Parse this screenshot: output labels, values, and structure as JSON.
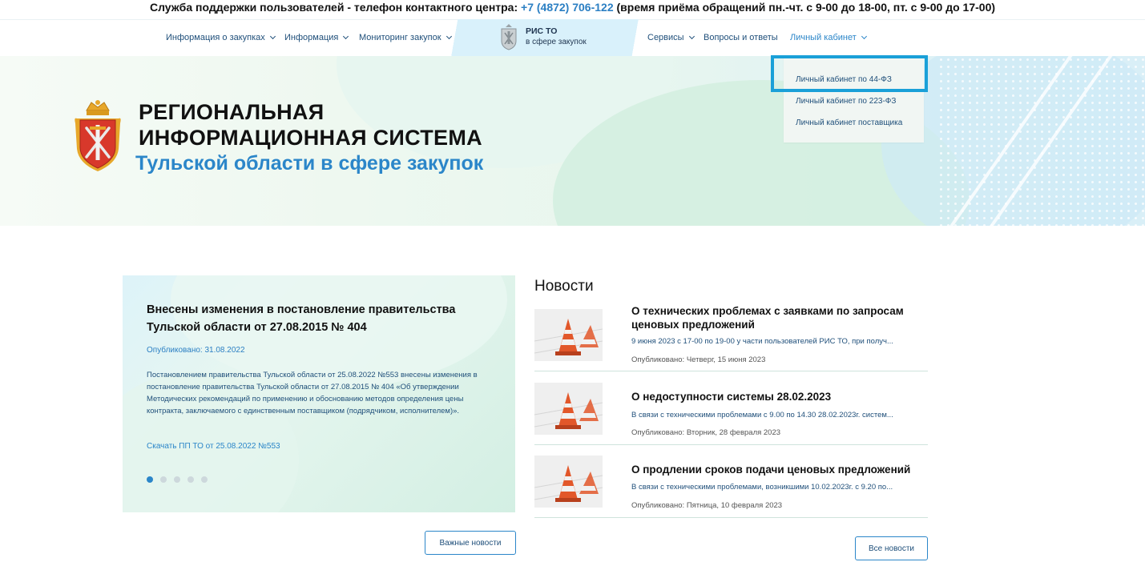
{
  "support": {
    "prefix": "Служба поддержки пользователей - телефон контактного центра: ",
    "phone": "+7 (4872) 706-122",
    "suffix": " (время приёма обращений пн.-чт. с 9-00 до 18-00, пт. с 9-00 до 17-00)"
  },
  "nav": {
    "left": [
      {
        "label": "Информация о закупках"
      },
      {
        "label": "Информация"
      },
      {
        "label": "Мониторинг закупок"
      }
    ],
    "right": [
      {
        "label": "Сервисы"
      },
      {
        "label": "Вопросы и ответы"
      },
      {
        "label": "Личный кабинет"
      }
    ],
    "logo_line1": "РИС ТО",
    "logo_line2": "в сфере закупок"
  },
  "hero": {
    "title_line1": "РЕГИОНАЛЬНАЯ",
    "title_line2": "ИНФОРМАЦИОННАЯ СИСТЕМА",
    "subtitle": "Тульской области в сфере закупок"
  },
  "dropdown": {
    "items": [
      {
        "label": "Личный кабинет по 44-ФЗ"
      },
      {
        "label": "Личный кабинет по 223-ФЗ"
      },
      {
        "label": "Личный кабинет поставщика"
      }
    ]
  },
  "slide": {
    "title": "Внесены изменения в постановление правительства Тульской области от 27.08.2015 № 404",
    "date": "Опубликовано: 31.08.2022",
    "text": "Постановлением правительства Тульской области от 25.08.2022 №553 внесены изменения в постановление правительства Тульской области от 27.08.2015 № 404 «Об утверждении Методических рекомендаций по применению и обоснованию методов определения цены контракта, заключаемого с единственным поставщиком (подрядчиком, исполнителем)».",
    "link": "Скачать ПП ТО от 25.08.2022 №553",
    "active_index": 0
  },
  "buttons": {
    "important": "Важные новости",
    "all": "Все новости"
  },
  "news": {
    "heading": "Новости",
    "items": [
      {
        "title": "О технических проблемах с заявками по запросам ценовых предложений",
        "summary": "9 июня 2023 с 17-00 по 19-00 у части пользователей РИС ТО, при получ...",
        "date": "Опубликовано: Четверг, 15 июня 2023"
      },
      {
        "title": "О недоступности системы 28.02.2023",
        "summary": "В связи с техническими проблемами с 9.00 по 14.30 28.02.2023г. систем...",
        "date": "Опубликовано: Вторник, 28 февраля 2023"
      },
      {
        "title": "О продлении сроков подачи ценовых предложений",
        "summary": "В связи с техническими проблемами, возникшими 10.02.2023г. с 9.20 по...",
        "date": "Опубликовано: Пятница, 10 февраля 2023"
      }
    ]
  },
  "colors": {
    "accent": "#2b86c9",
    "highlight": "#1aa0d8",
    "cone": "#e2572a"
  }
}
